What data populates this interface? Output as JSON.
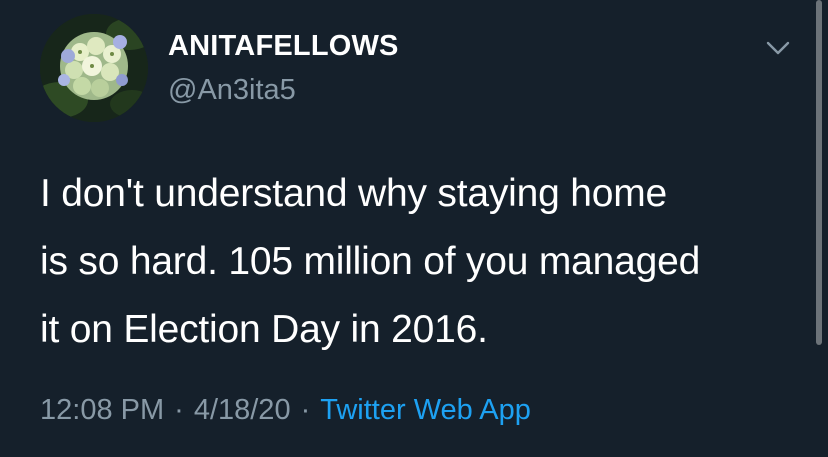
{
  "user": {
    "display_name": "ANITAFELLOWS",
    "handle": "@An3ita5",
    "avatar_icon": "hydrangea-avatar"
  },
  "tweet": {
    "lines": [
      "I don't understand why staying home",
      "is so hard. 105 million of you managed",
      "it on Election Day in 2016."
    ]
  },
  "meta": {
    "time": "12:08 PM",
    "separator": "·",
    "date": "4/18/20",
    "source": "Twitter Web App"
  },
  "icons": {
    "menu": "chevron-down-icon"
  },
  "colors": {
    "background": "#15202b",
    "text": "#ffffff",
    "secondary": "#8899a6",
    "link": "#1da1f2"
  }
}
